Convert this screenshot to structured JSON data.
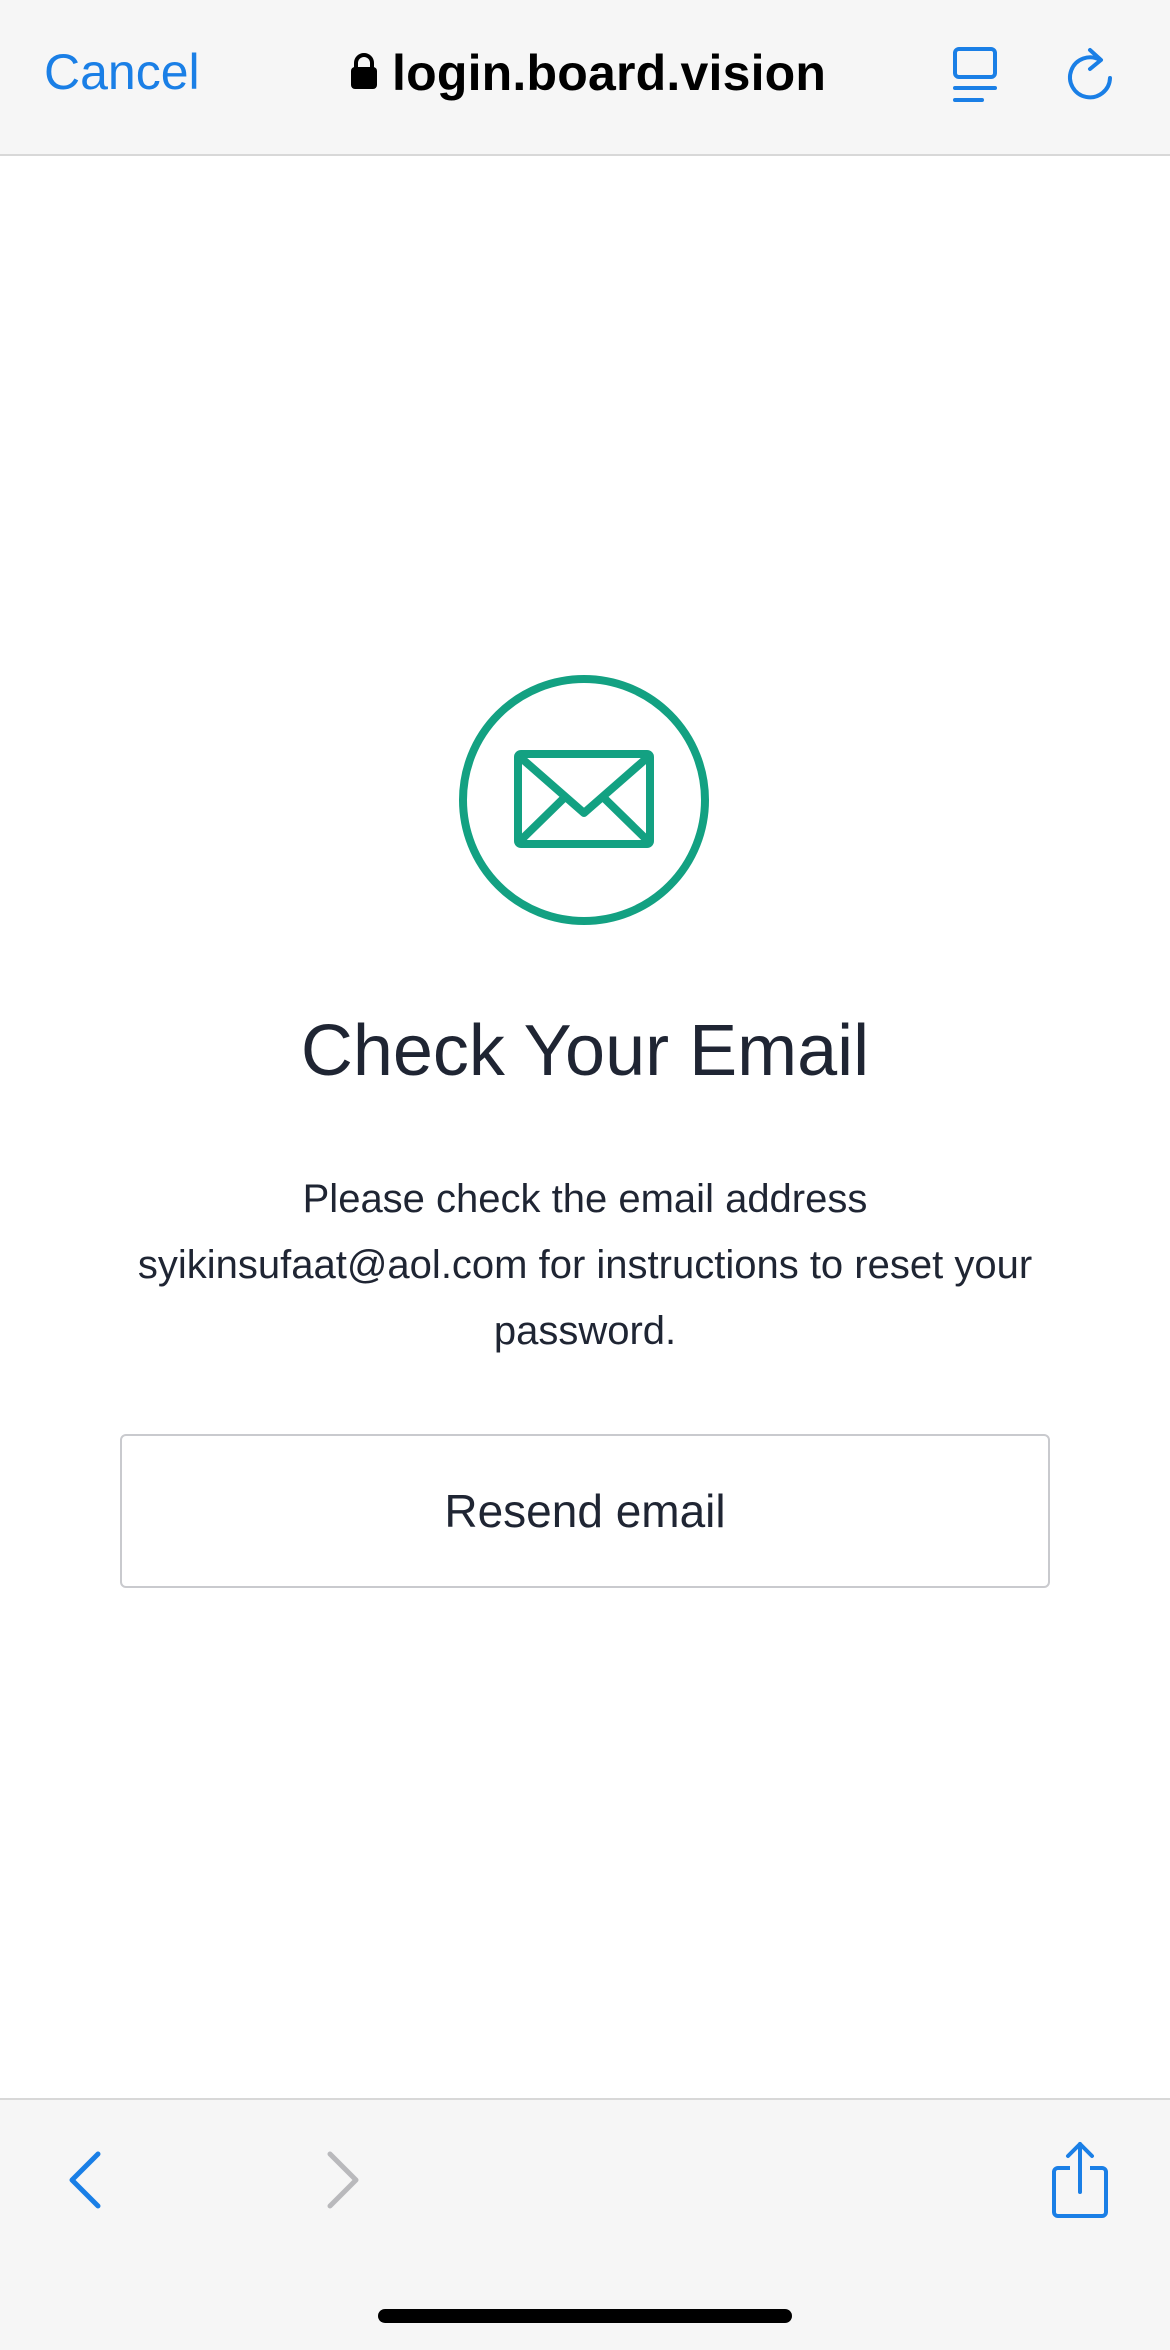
{
  "browser": {
    "cancel_label": "Cancel",
    "url": "login.board.vision",
    "icons": {
      "lock": "lock-icon",
      "reader": "reader-mode-icon",
      "reload": "reload-icon",
      "back": "back-arrow-icon",
      "forward": "forward-arrow-icon",
      "share": "share-icon"
    },
    "accent_color": "#1a7fe6",
    "disabled_color": "#b9b9bc"
  },
  "page": {
    "icon": "envelope-icon",
    "icon_color": "#13a182",
    "title": "Check Your Email",
    "message": "Please check the email address syikinsufaat@aol.com for instructions to reset your password.",
    "resend_button_label": "Resend email"
  }
}
